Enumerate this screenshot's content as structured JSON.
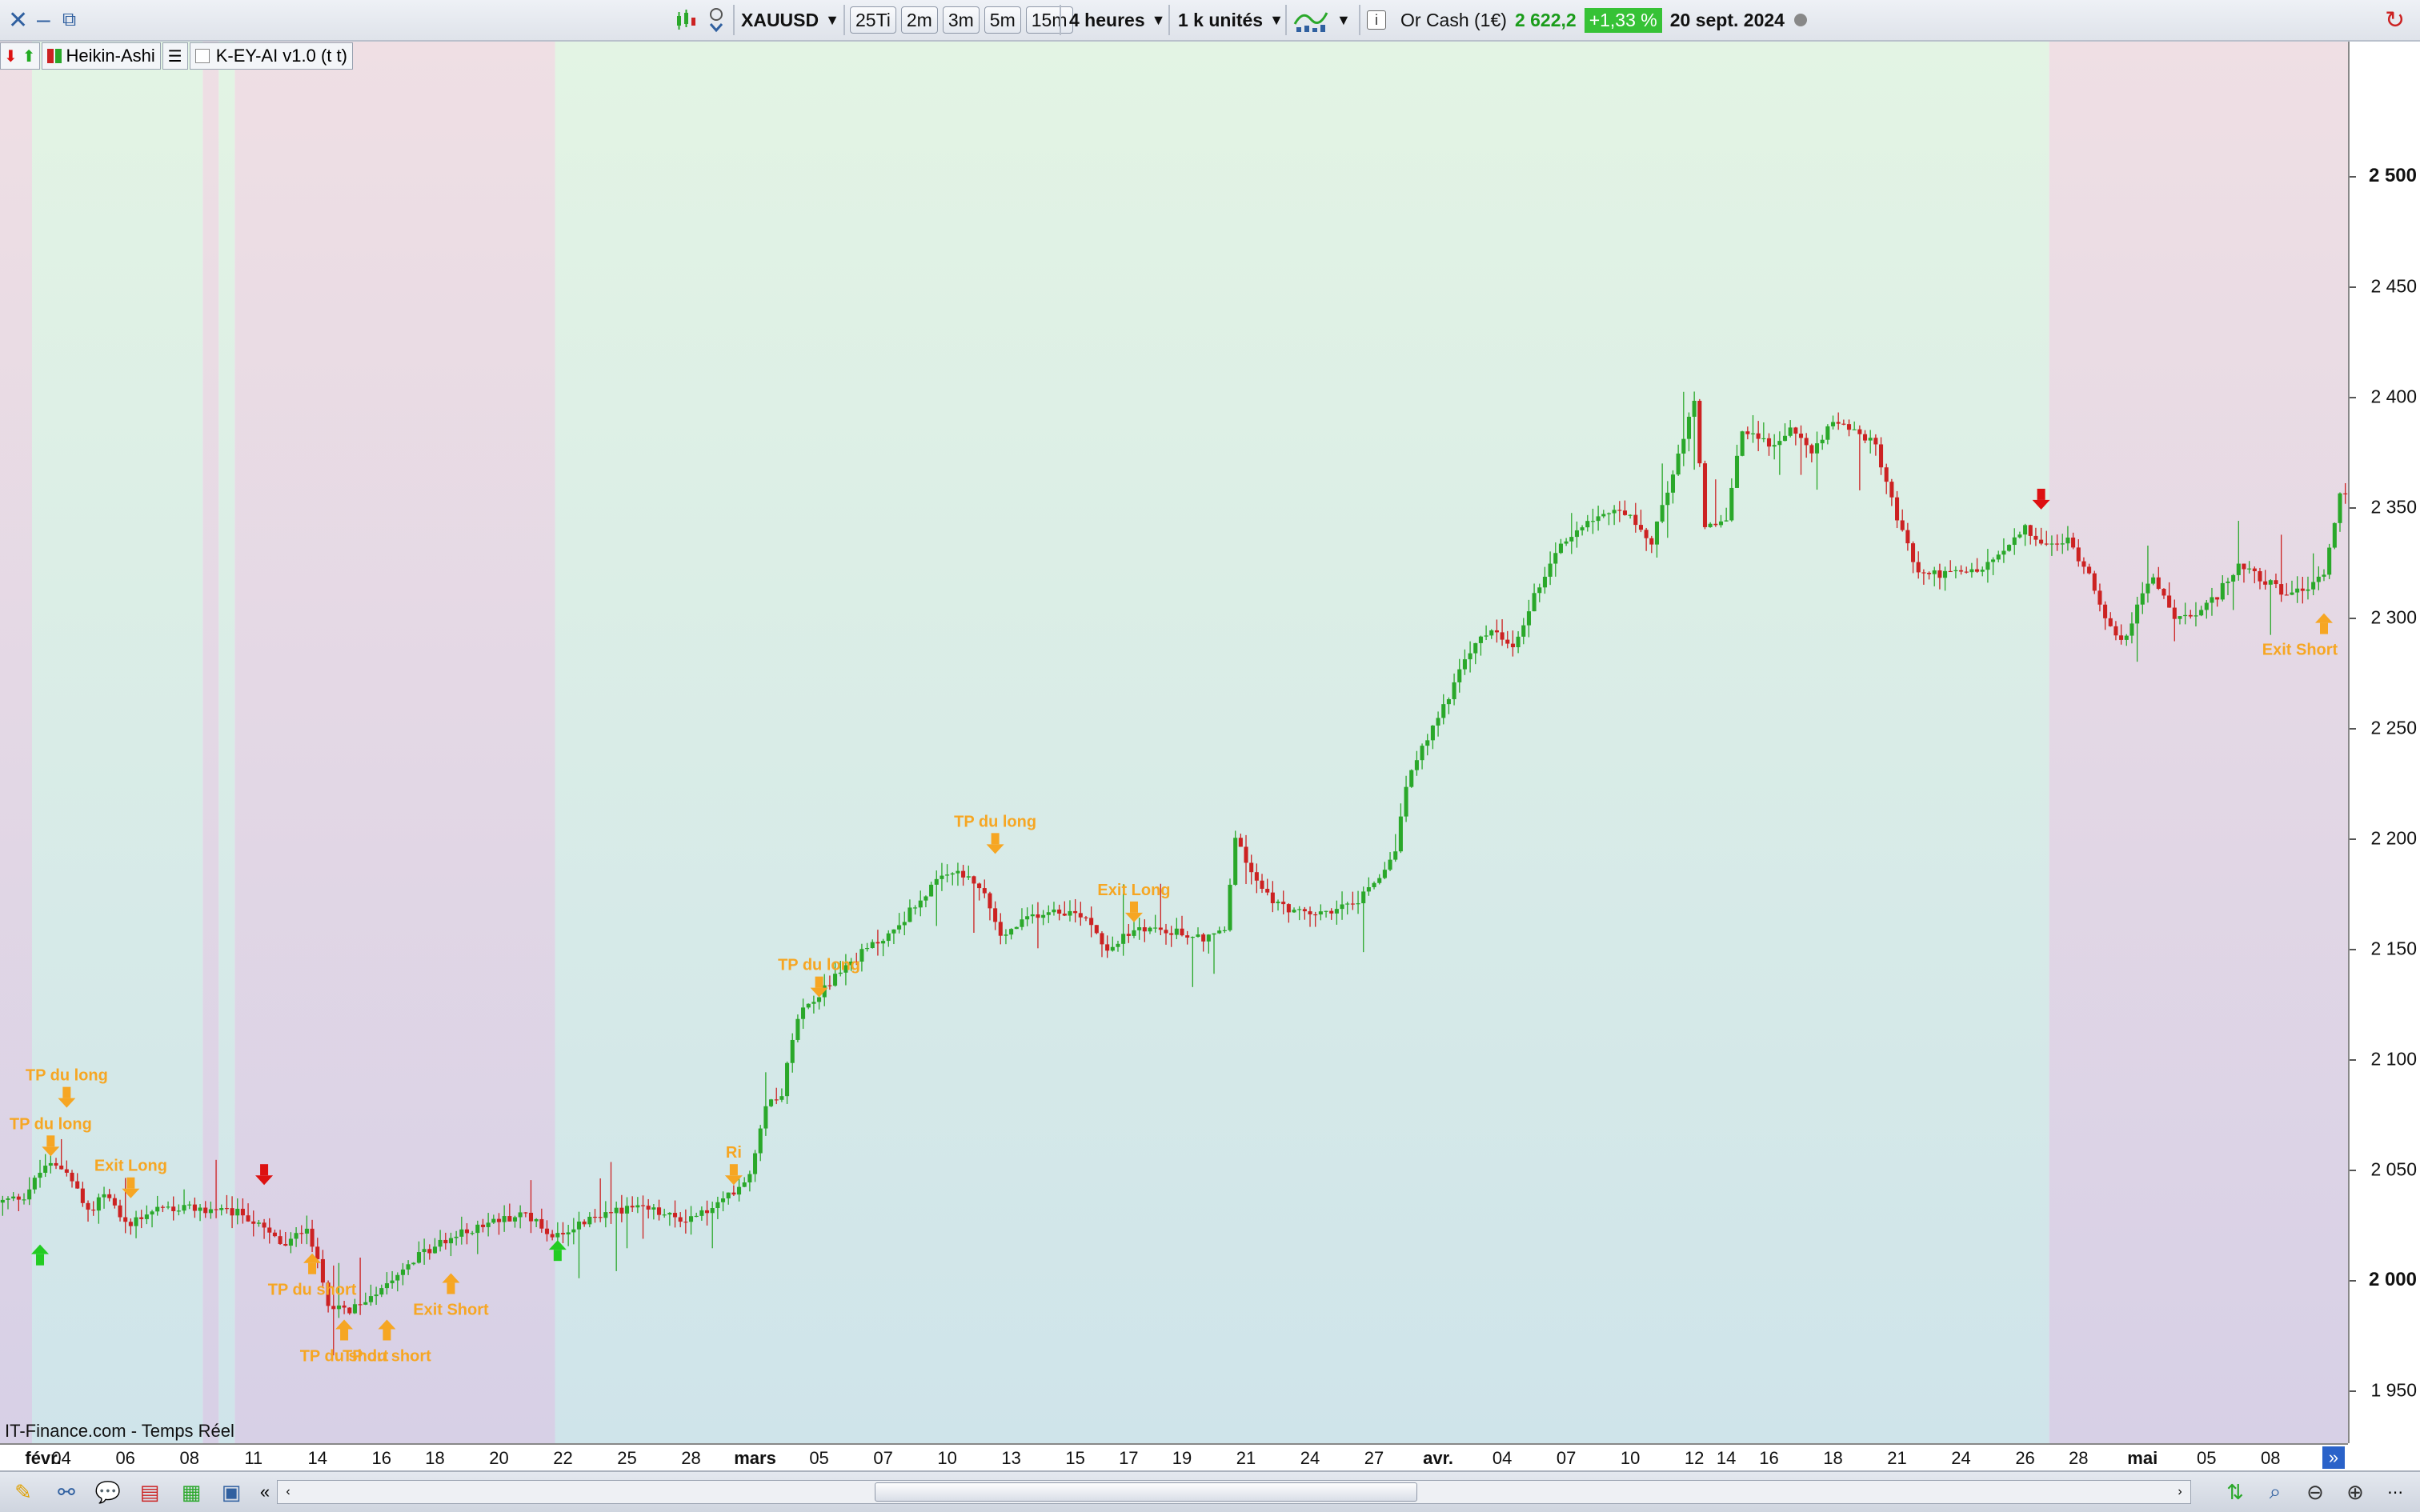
{
  "toolbar": {
    "instrument": "XAUUSD",
    "ticks_button": "25Ti",
    "tf_buttons": [
      "2m",
      "3m",
      "5m",
      "15m"
    ],
    "timeframe": "4 heures",
    "units": "1 k unités",
    "instrument_name": "Or Cash (1€)",
    "price": "2 622,2",
    "change": "+1,33 %",
    "date": "20 sept. 2024",
    "info_icon": "info-icon",
    "price_color": "#1a9c1a",
    "change_bg": "#36c236"
  },
  "indicators": {
    "chart_type": "Heikin-Ashi",
    "indicator": "K-EY-AI v1.0 (t t)"
  },
  "footer": {
    "source": "IT-Finance.com - Temps Réel"
  },
  "colors": {
    "bull": "#2aa82a",
    "bear": "#cc2222",
    "signal": "#f6a623",
    "arrow_up": "#22cc22",
    "arrow_down": "#dd1111",
    "zone_bull": "#e3f4e4",
    "zone_bear": "#efdfe4"
  },
  "chart_data": {
    "type": "candlestick",
    "y_ticks": [
      "2 500",
      "2 450",
      "2 400",
      "2 350",
      "2 300",
      "2 250",
      "2 200",
      "2 150",
      "2 100",
      "2 050",
      "2 000",
      "1 950"
    ],
    "y_tick_values": [
      2500,
      2450,
      2400,
      2350,
      2300,
      2250,
      2200,
      2150,
      2100,
      2050,
      2000,
      1950
    ],
    "y_bold": [
      "2 500",
      "2 000"
    ],
    "ylim": [
      1926,
      2561
    ],
    "x_labels": [
      {
        "label": "févr.",
        "i": 0,
        "bold": true
      },
      {
        "label": "04",
        "i": 11
      },
      {
        "label": "06",
        "i": 23
      },
      {
        "label": "08",
        "i": 35
      },
      {
        "label": "11",
        "i": 47
      },
      {
        "label": "14",
        "i": 59
      },
      {
        "label": "16",
        "i": 71
      },
      {
        "label": "18",
        "i": 81
      },
      {
        "label": "20",
        "i": 93
      },
      {
        "label": "22",
        "i": 105
      },
      {
        "label": "25",
        "i": 117
      },
      {
        "label": "28",
        "i": 129
      },
      {
        "label": "mars",
        "i": 141,
        "bold": true
      },
      {
        "label": "05",
        "i": 153
      },
      {
        "label": "07",
        "i": 165
      },
      {
        "label": "10",
        "i": 177
      },
      {
        "label": "13",
        "i": 189
      },
      {
        "label": "15",
        "i": 201
      },
      {
        "label": "17",
        "i": 211
      },
      {
        "label": "19",
        "i": 221
      },
      {
        "label": "21",
        "i": 233
      },
      {
        "label": "24",
        "i": 245
      },
      {
        "label": "27",
        "i": 257
      },
      {
        "label": "avr.",
        "i": 269,
        "bold": true
      },
      {
        "label": "04",
        "i": 281
      },
      {
        "label": "07",
        "i": 293
      },
      {
        "label": "10",
        "i": 305
      },
      {
        "label": "12",
        "i": 317
      },
      {
        "label": "14",
        "i": 323
      },
      {
        "label": "16",
        "i": 331
      },
      {
        "label": "18",
        "i": 343
      },
      {
        "label": "21",
        "i": 355
      },
      {
        "label": "24",
        "i": 367
      },
      {
        "label": "26",
        "i": 379
      },
      {
        "label": "28",
        "i": 389
      },
      {
        "label": "mai",
        "i": 401,
        "bold": true
      },
      {
        "label": "05",
        "i": 413
      },
      {
        "label": "08",
        "i": 425
      }
    ],
    "bars_count": 440,
    "path_points": [
      [
        0,
        2035
      ],
      [
        5,
        2038
      ],
      [
        9,
        2052
      ],
      [
        13,
        2050
      ],
      [
        17,
        2030
      ],
      [
        20,
        2040
      ],
      [
        24,
        2025
      ],
      [
        30,
        2033
      ],
      [
        38,
        2032
      ],
      [
        46,
        2030
      ],
      [
        54,
        2015
      ],
      [
        58,
        2025
      ],
      [
        62,
        1990
      ],
      [
        66,
        1985
      ],
      [
        71,
        1995
      ],
      [
        77,
        2008
      ],
      [
        84,
        2018
      ],
      [
        92,
        2026
      ],
      [
        99,
        2030
      ],
      [
        104,
        2020
      ],
      [
        110,
        2026
      ],
      [
        116,
        2032
      ],
      [
        122,
        2032
      ],
      [
        128,
        2027
      ],
      [
        134,
        2032
      ],
      [
        137,
        2038
      ],
      [
        141,
        2048
      ],
      [
        144,
        2080
      ],
      [
        147,
        2085
      ],
      [
        150,
        2120
      ],
      [
        154,
        2130
      ],
      [
        158,
        2140
      ],
      [
        163,
        2150
      ],
      [
        168,
        2158
      ],
      [
        172,
        2170
      ],
      [
        176,
        2180
      ],
      [
        180,
        2185
      ],
      [
        185,
        2175
      ],
      [
        188,
        2155
      ],
      [
        194,
        2165
      ],
      [
        198,
        2168
      ],
      [
        204,
        2165
      ],
      [
        208,
        2150
      ],
      [
        214,
        2160
      ],
      [
        220,
        2158
      ],
      [
        226,
        2155
      ],
      [
        230,
        2158
      ],
      [
        232,
        2200
      ],
      [
        236,
        2180
      ],
      [
        240,
        2170
      ],
      [
        246,
        2165
      ],
      [
        254,
        2170
      ],
      [
        258,
        2178
      ],
      [
        262,
        2195
      ],
      [
        264,
        2225
      ],
      [
        268,
        2245
      ],
      [
        272,
        2265
      ],
      [
        276,
        2285
      ],
      [
        280,
        2295
      ],
      [
        284,
        2285
      ],
      [
        288,
        2310
      ],
      [
        292,
        2330
      ],
      [
        298,
        2345
      ],
      [
        304,
        2350
      ],
      [
        310,
        2335
      ],
      [
        314,
        2365
      ],
      [
        318,
        2400
      ],
      [
        320,
        2340
      ],
      [
        324,
        2345
      ],
      [
        327,
        2385
      ],
      [
        332,
        2378
      ],
      [
        336,
        2385
      ],
      [
        340,
        2375
      ],
      [
        344,
        2390
      ],
      [
        348,
        2385
      ],
      [
        352,
        2378
      ],
      [
        356,
        2345
      ],
      [
        360,
        2320
      ],
      [
        364,
        2320
      ],
      [
        368,
        2320
      ],
      [
        372,
        2322
      ],
      [
        376,
        2330
      ],
      [
        380,
        2340
      ],
      [
        384,
        2332
      ],
      [
        388,
        2335
      ],
      [
        392,
        2320
      ],
      [
        396,
        2295
      ],
      [
        398,
        2288
      ],
      [
        402,
        2310
      ],
      [
        404,
        2318
      ],
      [
        408,
        2300
      ],
      [
        412,
        2300
      ],
      [
        416,
        2310
      ],
      [
        420,
        2325
      ],
      [
        424,
        2318
      ],
      [
        428,
        2312
      ],
      [
        432,
        2312
      ],
      [
        436,
        2320
      ],
      [
        439,
        2355
      ]
    ],
    "zones": [
      {
        "from": 0,
        "to": 6,
        "type": "bear"
      },
      {
        "from": 6,
        "to": 38,
        "type": "bull"
      },
      {
        "from": 38,
        "to": 41,
        "type": "bear"
      },
      {
        "from": 41,
        "to": 44,
        "type": "bull"
      },
      {
        "from": 44,
        "to": 104,
        "type": "bear"
      },
      {
        "from": 104,
        "to": 384,
        "type": "bull"
      },
      {
        "from": 384,
        "to": 440,
        "type": "bear"
      }
    ],
    "signals": [
      {
        "i": 12,
        "price": 2078,
        "kind": "down-orange",
        "label": "TP du long",
        "label_above": true
      },
      {
        "i": 9,
        "price": 2056,
        "kind": "down-orange",
        "label": "TP du long",
        "label_above": true
      },
      {
        "i": 24,
        "price": 2037,
        "kind": "down-orange",
        "label": "Exit Long",
        "label_above": true
      },
      {
        "i": 49,
        "price": 2043,
        "kind": "down-red"
      },
      {
        "i": 58,
        "price": 2012,
        "kind": "up-orange",
        "label": "TP du short",
        "label_above": false
      },
      {
        "i": 64,
        "price": 1982,
        "kind": "up-orange",
        "label": "TP du short",
        "label_above": false
      },
      {
        "i": 72,
        "price": 1982,
        "kind": "up-orange",
        "label": "TP du short",
        "label_above": false
      },
      {
        "i": 84,
        "price": 2003,
        "kind": "up-orange",
        "label": "Exit Short",
        "label_above": false
      },
      {
        "i": 7,
        "price": 2016,
        "kind": "up-green"
      },
      {
        "i": 104,
        "price": 2018,
        "kind": "up-green"
      },
      {
        "i": 137,
        "price": 2043,
        "kind": "down-orange",
        "label": "Ri",
        "label_above": true
      },
      {
        "i": 153,
        "price": 2128,
        "kind": "down-orange",
        "label": "TP du long",
        "label_above": true
      },
      {
        "i": 186,
        "price": 2193,
        "kind": "down-orange",
        "label": "TP du long",
        "label_above": true
      },
      {
        "i": 212,
        "price": 2162,
        "kind": "down-orange",
        "label": "Exit Long",
        "label_above": true
      },
      {
        "i": 382,
        "price": 2349,
        "kind": "down-red"
      },
      {
        "i": 450,
        "price": 2302,
        "kind": "up-orange",
        "label": "Exit Short",
        "label_above": false
      }
    ]
  }
}
